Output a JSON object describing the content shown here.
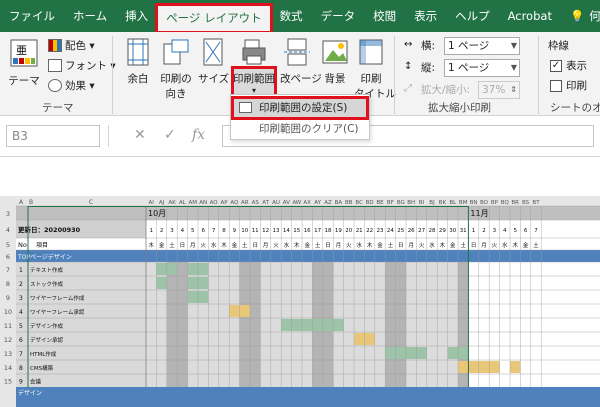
{
  "tabs": [
    "ファイル",
    "ホーム",
    "挿入",
    "ページ レイアウト",
    "数式",
    "データ",
    "校閲",
    "表示",
    "ヘルプ",
    "Acrobat",
    "何をしますか"
  ],
  "ribbon": {
    "theme": {
      "theme_label": "テーマ",
      "colors_label": "配色",
      "fonts_label": "フォント",
      "effects_label": "効果",
      "group_label": "テーマ"
    },
    "page_setup": {
      "margins": "余白",
      "orientation_1": "印刷の",
      "orientation_2": "向き",
      "size": "サイズ",
      "print_area": "印刷範囲",
      "breaks": "改ページ",
      "background": "背景",
      "print_titles_1": "印刷",
      "print_titles_2": "タイトル"
    },
    "scale": {
      "width_label": "横:",
      "width_value": "1 ページ",
      "height_label": "縦:",
      "height_value": "1 ページ",
      "scale_label": "拡大/縮小:",
      "scale_value": "37%",
      "group_label": "拡大縮小印刷"
    },
    "sheet_options": {
      "gridlines_label": "枠線",
      "view_label": "表示",
      "print_label": "印刷",
      "group_label": "シートのオプ"
    }
  },
  "dropdown": {
    "set_print_area": "印刷範囲の設定(S)",
    "clear_print_area": "印刷範囲のクリア(C)"
  },
  "formula_bar": {
    "name_box": "B3",
    "fx": "fx",
    "cancel": "✕",
    "enter": "✓"
  },
  "sheet": {
    "col_letters": [
      "A",
      "B",
      "C",
      "AI",
      "AJ",
      "AK",
      "AL",
      "AM",
      "AN",
      "AO",
      "AP",
      "AQ",
      "AR",
      "AS",
      "AT",
      "AU",
      "AV",
      "AW",
      "AX",
      "AY",
      "AZ",
      "BA",
      "BB",
      "BC",
      "BD",
      "BE",
      "BF",
      "BG",
      "BH",
      "BI",
      "BJ",
      "BK",
      "BL",
      "BM",
      "BN",
      "BO",
      "BP",
      "BQ",
      "BR",
      "BS",
      "BT"
    ],
    "row_numbers": [
      "3",
      "4",
      "5",
      "6",
      "7",
      "8",
      "9",
      "10",
      "11",
      "12",
      "13",
      "14",
      "15"
    ],
    "month_oct": "10月",
    "month_nov": "11月",
    "update_label": "更新日：20200930",
    "no_label": "No.",
    "item_label": "項目",
    "section_top": "TOPページデザイン",
    "section_next": "デザイン",
    "oct_days": [
      "1",
      "2",
      "3",
      "4",
      "5",
      "6",
      "7",
      "8",
      "9",
      "10",
      "11",
      "12",
      "13",
      "14",
      "15",
      "16",
      "17",
      "18",
      "19",
      "20",
      "21",
      "22",
      "23",
      "24",
      "25",
      "26",
      "27",
      "28",
      "29",
      "30",
      "31"
    ],
    "oct_weekdays": [
      "木",
      "金",
      "土",
      "日",
      "月",
      "火",
      "水",
      "木",
      "金",
      "土",
      "日",
      "月",
      "火",
      "水",
      "木",
      "金",
      "土",
      "日",
      "月",
      "火",
      "水",
      "木",
      "金",
      "土",
      "日",
      "月",
      "火",
      "水",
      "木",
      "金",
      "土"
    ],
    "nov_days": [
      "1",
      "2",
      "3",
      "4",
      "5",
      "6",
      "7"
    ],
    "nov_weekdays": [
      "日",
      "月",
      "火",
      "水",
      "木",
      "金",
      "土"
    ],
    "tasks": [
      {
        "no": "1",
        "name": "テキスト作成"
      },
      {
        "no": "2",
        "name": "ストック作成"
      },
      {
        "no": "3",
        "name": "ワイヤーフレーム作成"
      },
      {
        "no": "4",
        "name": "ワイヤーフレーム承認"
      },
      {
        "no": "5",
        "name": "デザイン作成"
      },
      {
        "no": "6",
        "name": "デザイン承認"
      },
      {
        "no": "7",
        "name": "HTML作成"
      },
      {
        "no": "8",
        "name": "CMS構築"
      },
      {
        "no": "9",
        "name": "会議"
      }
    ],
    "colors": {
      "green": "#9dc3a8",
      "yellow": "#e8c878",
      "weekend": "#b4b4b4",
      "blue": "#4f81bd"
    }
  }
}
